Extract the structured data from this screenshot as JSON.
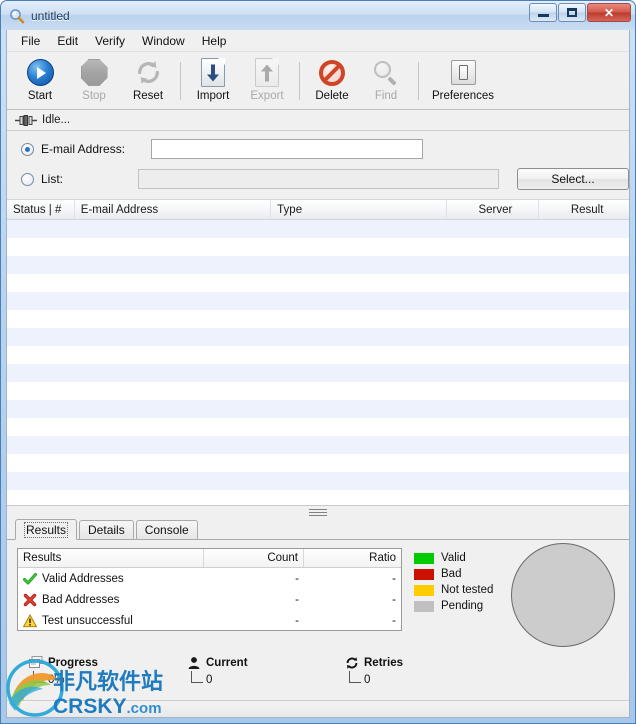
{
  "window": {
    "title": "untitled",
    "icon": "magnifier-icon",
    "controls": {
      "minimize": "Minimize",
      "maximize": "Maximize",
      "close": "Close"
    }
  },
  "menu": {
    "items": [
      {
        "label": "File"
      },
      {
        "label": "Edit"
      },
      {
        "label": "Verify"
      },
      {
        "label": "Window"
      },
      {
        "label": "Help"
      }
    ]
  },
  "toolbar": {
    "buttons": [
      {
        "label": "Start",
        "icon": "play-icon",
        "enabled": true
      },
      {
        "label": "Stop",
        "icon": "stop-octagon-icon",
        "enabled": false
      },
      {
        "label": "Reset",
        "icon": "refresh-icon",
        "enabled": true
      },
      {
        "label": "Import",
        "icon": "document-down-arrow-icon",
        "enabled": true
      },
      {
        "label": "Export",
        "icon": "document-up-arrow-icon",
        "enabled": false
      },
      {
        "label": "Delete",
        "icon": "prohibition-icon",
        "enabled": true
      },
      {
        "label": "Find",
        "icon": "magnifier-icon",
        "enabled": false
      },
      {
        "label": "Preferences",
        "icon": "light-switch-icon",
        "enabled": true
      }
    ]
  },
  "status_strip": {
    "icon": "connector-plug-icon",
    "text": "Idle..."
  },
  "input_section": {
    "email_option": {
      "label": "E-mail Address:",
      "selected": true,
      "value": "",
      "placeholder": ""
    },
    "list_option": {
      "label": "List:",
      "selected": false,
      "value": "",
      "placeholder": ""
    },
    "select_button": "Select..."
  },
  "list_view": {
    "columns": [
      {
        "label": "Status | #"
      },
      {
        "label": "E-mail Address"
      },
      {
        "label": "Type"
      },
      {
        "label": "Server"
      },
      {
        "label": "Result"
      }
    ],
    "rows": []
  },
  "tabs": [
    {
      "label": "Results",
      "active": true
    },
    {
      "label": "Details",
      "active": false
    },
    {
      "label": "Console",
      "active": false
    }
  ],
  "results_panel": {
    "table": {
      "columns": [
        "Results",
        "Count",
        "Ratio"
      ],
      "rows": [
        {
          "icon": "green-check-icon",
          "label": "Valid Addresses",
          "count": "-",
          "ratio": "-"
        },
        {
          "icon": "red-x-icon",
          "label": "Bad Addresses",
          "count": "-",
          "ratio": "-"
        },
        {
          "icon": "warning-triangle-icon",
          "label": "Test unsuccessful",
          "count": "-",
          "ratio": "-"
        }
      ]
    },
    "legend": [
      {
        "label": "Valid",
        "color": "#00cc00"
      },
      {
        "label": "Bad",
        "color": "#cc1100"
      },
      {
        "label": "Not tested",
        "color": "#ffcc00"
      },
      {
        "label": "Pending",
        "color": "#c0c0c0"
      }
    ],
    "chart_data": {
      "type": "pie",
      "title": "",
      "categories": [
        "Valid",
        "Bad",
        "Not tested",
        "Pending"
      ],
      "values": [
        0,
        0,
        0,
        100
      ],
      "colors": [
        "#00cc00",
        "#cc1100",
        "#ffcc00",
        "#c0c0c0"
      ],
      "legend_position": "left"
    }
  },
  "bottom_stats": [
    {
      "label": "Progress",
      "icon": "progress-icon",
      "value": "0%"
    },
    {
      "label": "Current",
      "icon": "person-icon",
      "value": "0"
    },
    {
      "label": "Retries",
      "icon": "retry-icon",
      "value": "0"
    }
  ],
  "watermark": {
    "cn_text": "非凡软件站",
    "brand": "CRSKY",
    "domain": ".com"
  }
}
